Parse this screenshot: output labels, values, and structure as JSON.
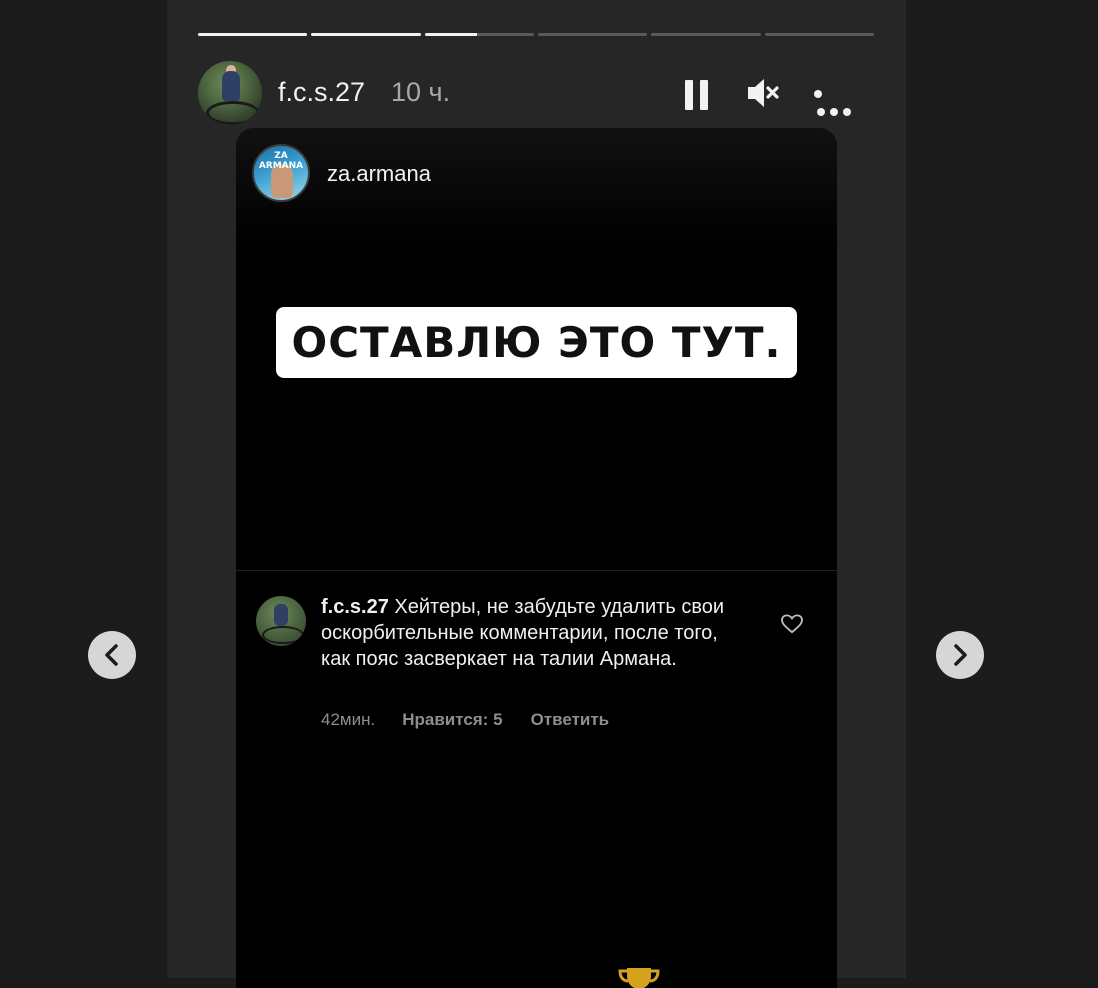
{
  "story": {
    "progress": [
      1,
      1,
      0.48,
      0,
      0,
      0
    ],
    "username": "f.c.s.27",
    "time": "10 ч.",
    "controls": {
      "pause_icon": "pause-icon",
      "mute_icon": "speaker-muted-icon",
      "more_icon": "more-horizontal-icon"
    }
  },
  "post": {
    "username": "za.armana",
    "avatar_logo_line1": "ZA",
    "avatar_logo_line2": "ARMANA",
    "banner_text": "ОСТАВЛЮ ЭТО ТУТ.",
    "comment": {
      "username": "f.c.s.27",
      "text": "Хейтеры, не забудьте удалить свои оскорбительные комментарии, после того, как пояс засверкает на талии Армана.",
      "time": "42мин.",
      "likes": "Нравится: 5",
      "reply": "Ответить"
    }
  },
  "nav": {
    "prev_icon": "chevron-left-icon",
    "next_icon": "chevron-right-icon"
  },
  "colors": {
    "page_bg": "#1b1b1b",
    "story_bg": "#262626",
    "post_bg": "#000000",
    "text_primary": "#f2f2f2",
    "text_muted": "#a8a8a8"
  }
}
